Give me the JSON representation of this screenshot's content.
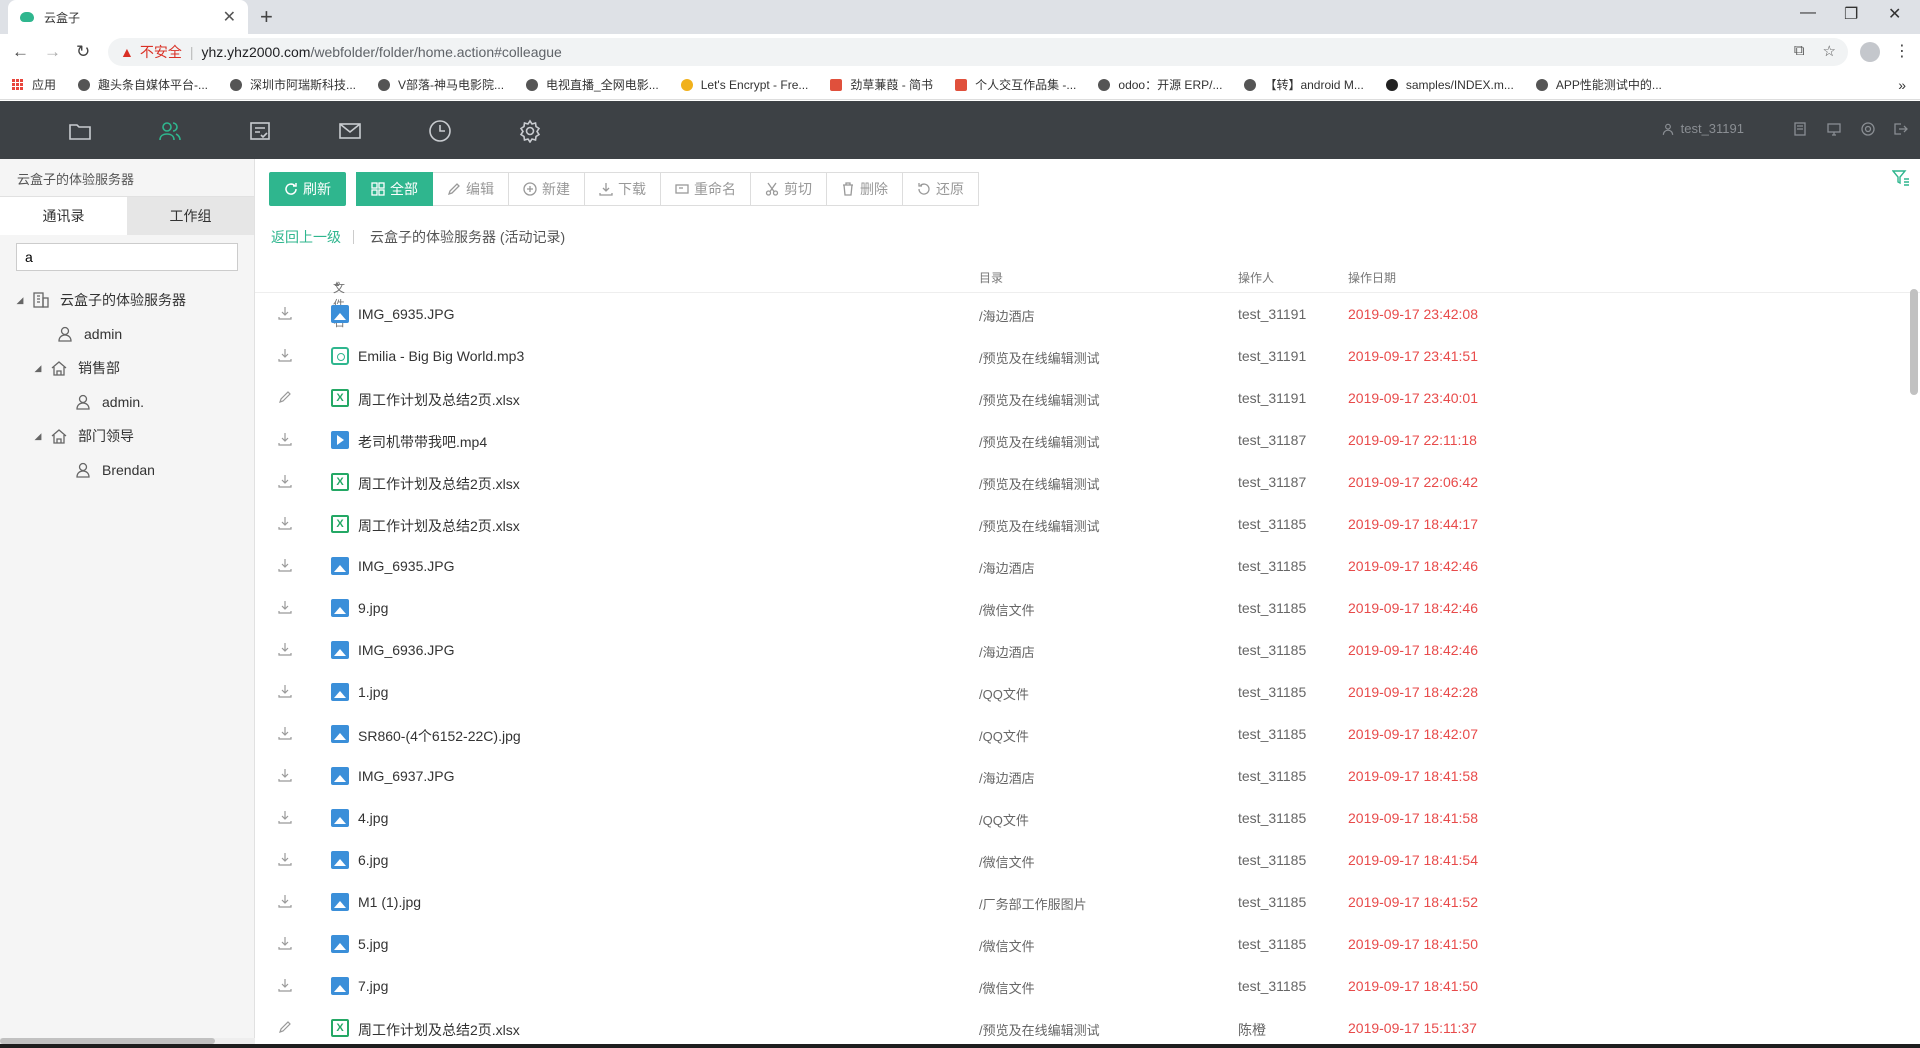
{
  "browser": {
    "tab_title": "云盒子",
    "not_secure": "不安全",
    "url_host": "yhz.yhz2000.com",
    "url_path": "/webfolder/folder/home.action#colleague",
    "bookmarks": [
      {
        "label": "应用",
        "icon": "apps-grid-icon"
      },
      {
        "label": "趣头条自媒体平台-...",
        "icon": "site-icon"
      },
      {
        "label": "深圳市阿瑞斯科技...",
        "icon": "site-icon"
      },
      {
        "label": "V部落-神马电影院...",
        "icon": "site-icon"
      },
      {
        "label": "电视直播_全网电影...",
        "icon": "site-icon"
      },
      {
        "label": "Let's Encrypt - Fre...",
        "icon": "site-icon"
      },
      {
        "label": "劲草蒹葭 - 简书",
        "icon": "jianshu-icon"
      },
      {
        "label": "个人交互作品集 -...",
        "icon": "jianshu-icon"
      },
      {
        "label": "odoo：开源 ERP/...",
        "icon": "site-icon"
      },
      {
        "label": "【转】android M...",
        "icon": "site-icon"
      },
      {
        "label": "samples/INDEX.m...",
        "icon": "github-icon"
      },
      {
        "label": "APP性能测试中的...",
        "icon": "site-icon"
      }
    ]
  },
  "header": {
    "username": "test_31191"
  },
  "sidebar": {
    "server_title": "云盒子的体验服务器",
    "tabs": [
      "通讯录",
      "工作组"
    ],
    "search_value": "a",
    "tree": [
      {
        "label": "云盒子的体验服务器",
        "level": 0,
        "type": "org",
        "expanded": true
      },
      {
        "label": "admin",
        "level": 1,
        "type": "user"
      },
      {
        "label": "销售部",
        "level": 1,
        "type": "dept",
        "expanded": true
      },
      {
        "label": "admin.",
        "level": 2,
        "type": "user"
      },
      {
        "label": "部门领导",
        "level": 1,
        "type": "dept",
        "expanded": true
      },
      {
        "label": "Brendan",
        "level": 2,
        "type": "user"
      }
    ]
  },
  "toolbar": {
    "refresh": "刷新",
    "all": "全部",
    "edit": "编辑",
    "new": "新建",
    "download": "下载",
    "rename": "重命名",
    "cut": "剪切",
    "delete": "删除",
    "restore": "还原"
  },
  "breadcrumb": {
    "back": "返回上一级",
    "current": "云盒子的体验服务器 (活动记录)"
  },
  "table": {
    "columns": [
      "文件名",
      "目录",
      "操作人",
      "操作日期"
    ],
    "sort_indicator": "▲",
    "rows": [
      {
        "action": "download",
        "type": "img",
        "name": "IMG_6935.JPG",
        "dir": "/海边酒店",
        "op": "test_31191",
        "date": "2019-09-17 23:42:08"
      },
      {
        "action": "download",
        "type": "mp3",
        "name": "Emilia - Big Big World.mp3",
        "dir": "/预览及在线编辑测试",
        "op": "test_31191",
        "date": "2019-09-17 23:41:51"
      },
      {
        "action": "edit",
        "type": "xls",
        "name": "周工作计划及总结2页.xlsx",
        "dir": "/预览及在线编辑测试",
        "op": "test_31191",
        "date": "2019-09-17 23:40:01"
      },
      {
        "action": "download",
        "type": "mp4",
        "name": "老司机带带我吧.mp4",
        "dir": "/预览及在线编辑测试",
        "op": "test_31187",
        "date": "2019-09-17 22:11:18"
      },
      {
        "action": "download",
        "type": "xls",
        "name": "周工作计划及总结2页.xlsx",
        "dir": "/预览及在线编辑测试",
        "op": "test_31187",
        "date": "2019-09-17 22:06:42"
      },
      {
        "action": "download",
        "type": "xls",
        "name": "周工作计划及总结2页.xlsx",
        "dir": "/预览及在线编辑测试",
        "op": "test_31185",
        "date": "2019-09-17 18:44:17"
      },
      {
        "action": "download",
        "type": "img",
        "name": "IMG_6935.JPG",
        "dir": "/海边酒店",
        "op": "test_31185",
        "date": "2019-09-17 18:42:46"
      },
      {
        "action": "download",
        "type": "img",
        "name": "9.jpg",
        "dir": "/微信文件",
        "op": "test_31185",
        "date": "2019-09-17 18:42:46"
      },
      {
        "action": "download",
        "type": "img",
        "name": "IMG_6936.JPG",
        "dir": "/海边酒店",
        "op": "test_31185",
        "date": "2019-09-17 18:42:46"
      },
      {
        "action": "download",
        "type": "img",
        "name": "1.jpg",
        "dir": "/QQ文件",
        "op": "test_31185",
        "date": "2019-09-17 18:42:28"
      },
      {
        "action": "download",
        "type": "img",
        "name": "SR860-(4个6152-22C).jpg",
        "dir": "/QQ文件",
        "op": "test_31185",
        "date": "2019-09-17 18:42:07"
      },
      {
        "action": "download",
        "type": "img",
        "name": "IMG_6937.JPG",
        "dir": "/海边酒店",
        "op": "test_31185",
        "date": "2019-09-17 18:41:58"
      },
      {
        "action": "download",
        "type": "img",
        "name": "4.jpg",
        "dir": "/QQ文件",
        "op": "test_31185",
        "date": "2019-09-17 18:41:58"
      },
      {
        "action": "download",
        "type": "img",
        "name": "6.jpg",
        "dir": "/微信文件",
        "op": "test_31185",
        "date": "2019-09-17 18:41:54"
      },
      {
        "action": "download",
        "type": "img",
        "name": "M1 (1).jpg",
        "dir": "/厂务部工作服图片",
        "op": "test_31185",
        "date": "2019-09-17 18:41:52"
      },
      {
        "action": "download",
        "type": "img",
        "name": "5.jpg",
        "dir": "/微信文件",
        "op": "test_31185",
        "date": "2019-09-17 18:41:50"
      },
      {
        "action": "download",
        "type": "img",
        "name": "7.jpg",
        "dir": "/微信文件",
        "op": "test_31185",
        "date": "2019-09-17 18:41:50"
      },
      {
        "action": "edit",
        "type": "xls",
        "name": "周工作计划及总结2页.xlsx",
        "dir": "/预览及在线编辑测试",
        "op": "陈橙",
        "date": "2019-09-17 15:11:37"
      }
    ]
  },
  "colors": {
    "accent": "#2fb68e",
    "header_bg": "#3d4145",
    "date_red": "#e84a4a"
  }
}
